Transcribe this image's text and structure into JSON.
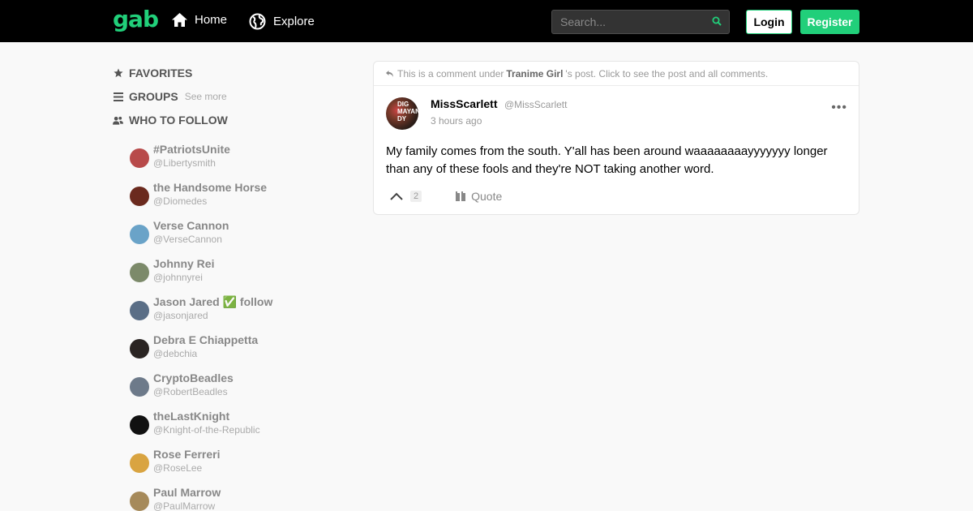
{
  "topbar": {
    "logo": "gab",
    "nav": [
      {
        "label": "Home",
        "icon": "home-icon"
      },
      {
        "label": "Explore",
        "icon": "globe-icon"
      }
    ],
    "search_placeholder": "Search...",
    "login_label": "Login",
    "register_label": "Register"
  },
  "sidebar": {
    "favorites_label": "FAVORITES",
    "groups_label": "GROUPS",
    "groups_see_more": "See more",
    "who_to_follow_label": "WHO TO FOLLOW",
    "follow": [
      {
        "name": "#PatriotsUnite",
        "handle": "@Libertysmith",
        "avatar_color": "#b84a4a"
      },
      {
        "name": "the Handsome Horse",
        "handle": "@Diomedes",
        "avatar_color": "#6b2a1e"
      },
      {
        "name": "Verse Cannon",
        "handle": "@VerseCannon",
        "avatar_color": "#6aa3c8"
      },
      {
        "name": "Johnny Rei",
        "handle": "@johnnyrei",
        "avatar_color": "#7c8a6a"
      },
      {
        "name": "Jason Jared ✅ follow",
        "handle": "@jasonjared",
        "avatar_color": "#5a6e86"
      },
      {
        "name": "Debra E Chiappetta",
        "handle": "@debchia",
        "avatar_color": "#2a2422"
      },
      {
        "name": "CryptoBeadles",
        "handle": "@RobertBeadles",
        "avatar_color": "#6d7a8a"
      },
      {
        "name": "theLastKnight",
        "handle": "@Knight-of-the-Republic",
        "avatar_color": "#111111"
      },
      {
        "name": "Rose Ferreri",
        "handle": "@RoseLee",
        "avatar_color": "#d9a441"
      },
      {
        "name": "Paul Marrow",
        "handle": "@PaulMarrow",
        "avatar_color": "#a68a5a"
      }
    ]
  },
  "post": {
    "notice_prefix": "This is a comment under",
    "notice_user": "Tranime Girl",
    "notice_suffix": "'s post. Click to see the post and all comments.",
    "author": "MissScarlett",
    "handle": "@MissScarlett",
    "time": "3 hours ago",
    "body": "My family comes from the south. Y'all has been around waaaaaaaayyyyyyy longer than any of these fools and they're NOT taking another word.",
    "upvotes": "2",
    "quote_label": "Quote",
    "more_label": "•••",
    "avatar_text": "DIG MAYAN DY"
  },
  "colors": {
    "brand": "#21cf7a",
    "topbar": "#000000",
    "background": "#f9f9f9"
  }
}
